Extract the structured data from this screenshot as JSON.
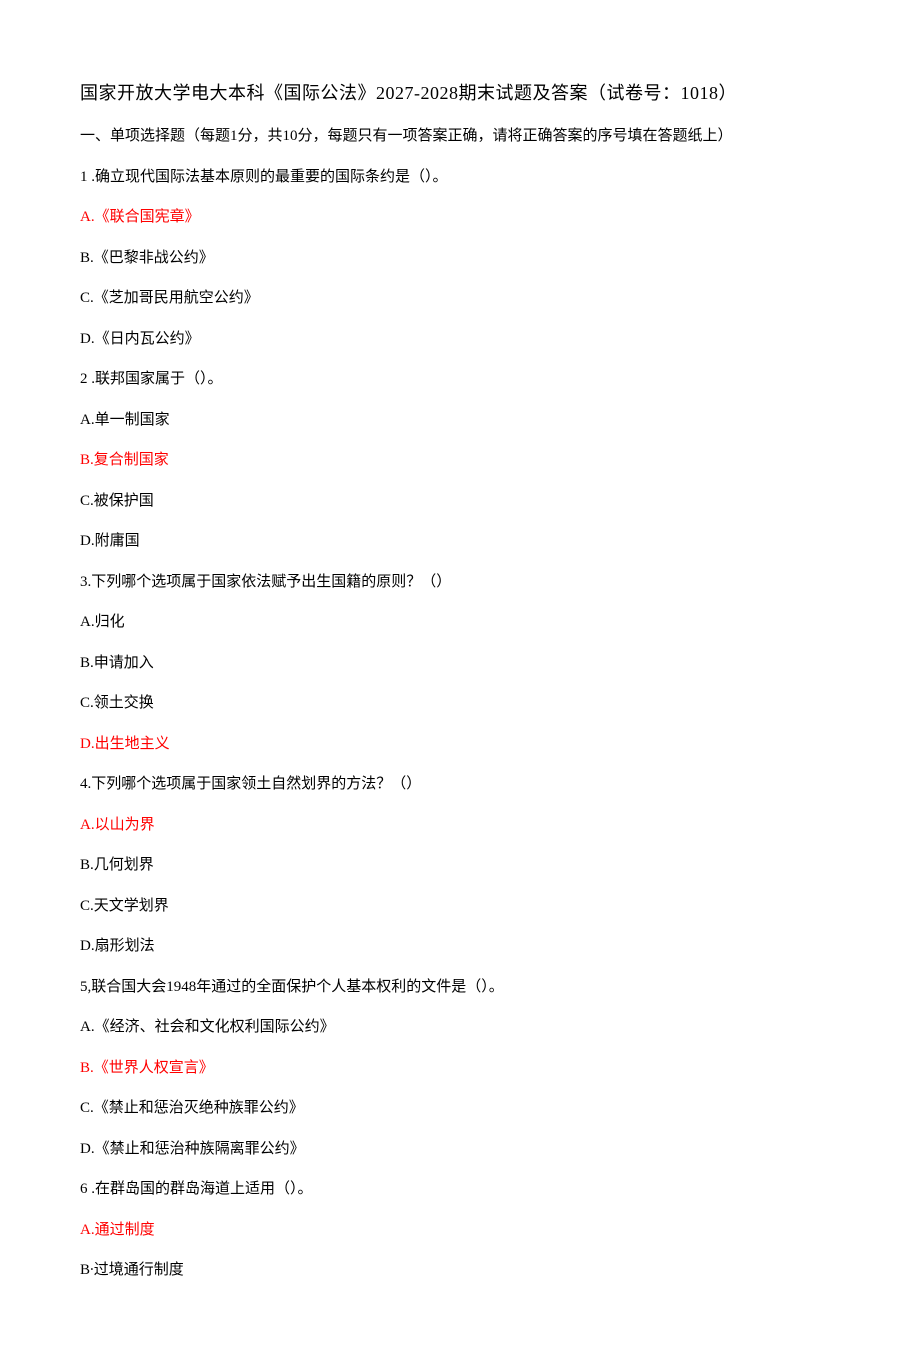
{
  "title": "国家开放大学电大本科《国际公法》2027-2028期末试题及答案（试卷号：1018）",
  "section_header": "一、单项选择题（每题1分，共10分，每题只有一项答案正确，请将正确答案的序号填在答题纸上）",
  "q1": {
    "text": "1 .确立现代国际法基本原则的最重要的国际条约是（）。",
    "a": "A.《联合国宪章》",
    "b": "B.《巴黎非战公约》",
    "c": "C.《芝加哥民用航空公约》",
    "d": "D.《日内瓦公约》"
  },
  "q2": {
    "text": "2 .联邦国家属于（）。",
    "a": "A.单一制国家",
    "b": "B.复合制国家",
    "c": "C.被保护国",
    "d": "D.附庸国"
  },
  "q3": {
    "text": "3.下列哪个选项属于国家依法赋予出生国籍的原则？（）",
    "a": "A.归化",
    "b": "B.申请加入",
    "c": "C.领土交换",
    "d": "D.出生地主义"
  },
  "q4": {
    "text": "4.下列哪个选项属于国家领土自然划界的方法？（）",
    "a": "A.以山为界",
    "b": "B.几何划界",
    "c": "C.天文学划界",
    "d": "D.扇形划法"
  },
  "q5": {
    "text": "5,联合国大会1948年通过的全面保护个人基本权利的文件是（）。",
    "a": "A.《经济、社会和文化权利国际公约》",
    "b": "B.《世界人权宣言》",
    "c": "C.《禁止和惩治灭绝种族罪公约》",
    "d": "D.《禁止和惩治种族隔离罪公约》"
  },
  "q6": {
    "text": "6 .在群岛国的群岛海道上适用（）。",
    "a": "A.通过制度",
    "b": "B∙过境通行制度"
  }
}
